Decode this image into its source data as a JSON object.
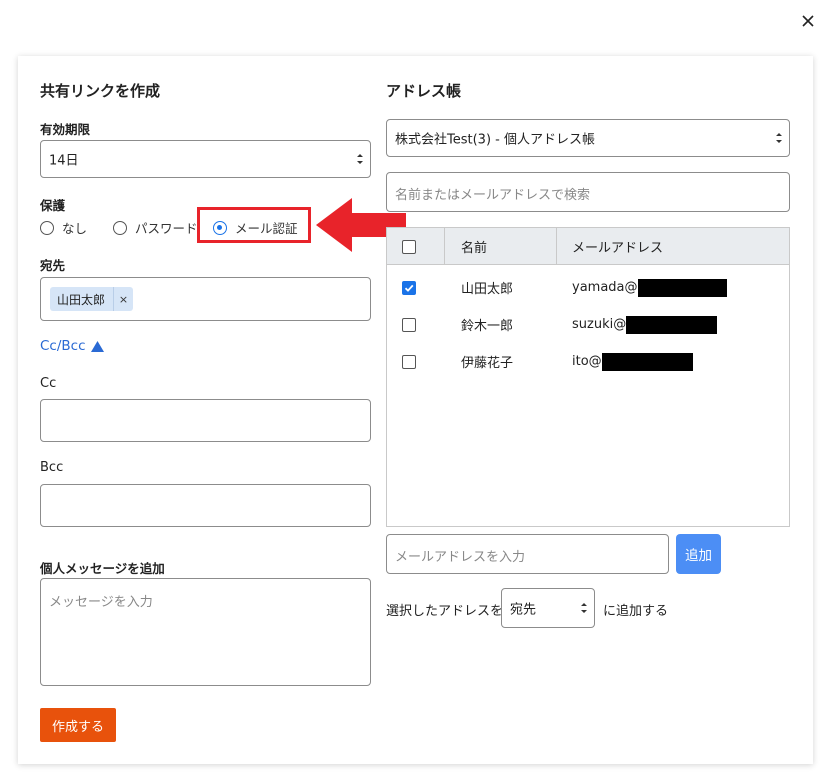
{
  "close_label": "×",
  "left": {
    "title": "共有リンクを作成",
    "expiry": {
      "label": "有効期限",
      "value": "14日"
    },
    "protection": {
      "label": "保護",
      "options": [
        {
          "label": "なし",
          "selected": false
        },
        {
          "label": "パスワード",
          "selected": false
        },
        {
          "label": "メール認証",
          "selected": true
        }
      ]
    },
    "to": {
      "label": "宛先",
      "chips": [
        "山田太郎"
      ],
      "chip_remove": "×"
    },
    "ccbcc_toggle": "Cc/Bcc",
    "cc": {
      "label": "Cc",
      "value": ""
    },
    "bcc": {
      "label": "Bcc",
      "value": ""
    },
    "message": {
      "label": "個人メッセージを追加",
      "placeholder": "メッセージを入力"
    },
    "create_button": "作成する"
  },
  "right": {
    "title": "アドレス帳",
    "book_select": "株式会社Test(3) - 個人アドレス帳",
    "search_placeholder": "名前またはメールアドレスで検索",
    "table": {
      "columns": [
        "名前",
        "メールアドレス"
      ],
      "rows": [
        {
          "name": "山田太郎",
          "email": "yamada@",
          "checked": true
        },
        {
          "name": "鈴木一郎",
          "email": "suzuki@",
          "checked": false
        },
        {
          "name": "伊藤花子",
          "email": "ito@",
          "checked": false
        }
      ]
    },
    "email_input_placeholder": "メールアドレスを入力",
    "add_button": "追加",
    "add_to_prefix": "選択したアドレスを",
    "add_to_select": "宛先",
    "add_to_suffix": "に追加する"
  },
  "colors": {
    "accent_blue": "#1a73e8",
    "create_orange": "#e8520c",
    "add_blue": "#4c8ef5",
    "highlight_red": "#e8232a"
  }
}
